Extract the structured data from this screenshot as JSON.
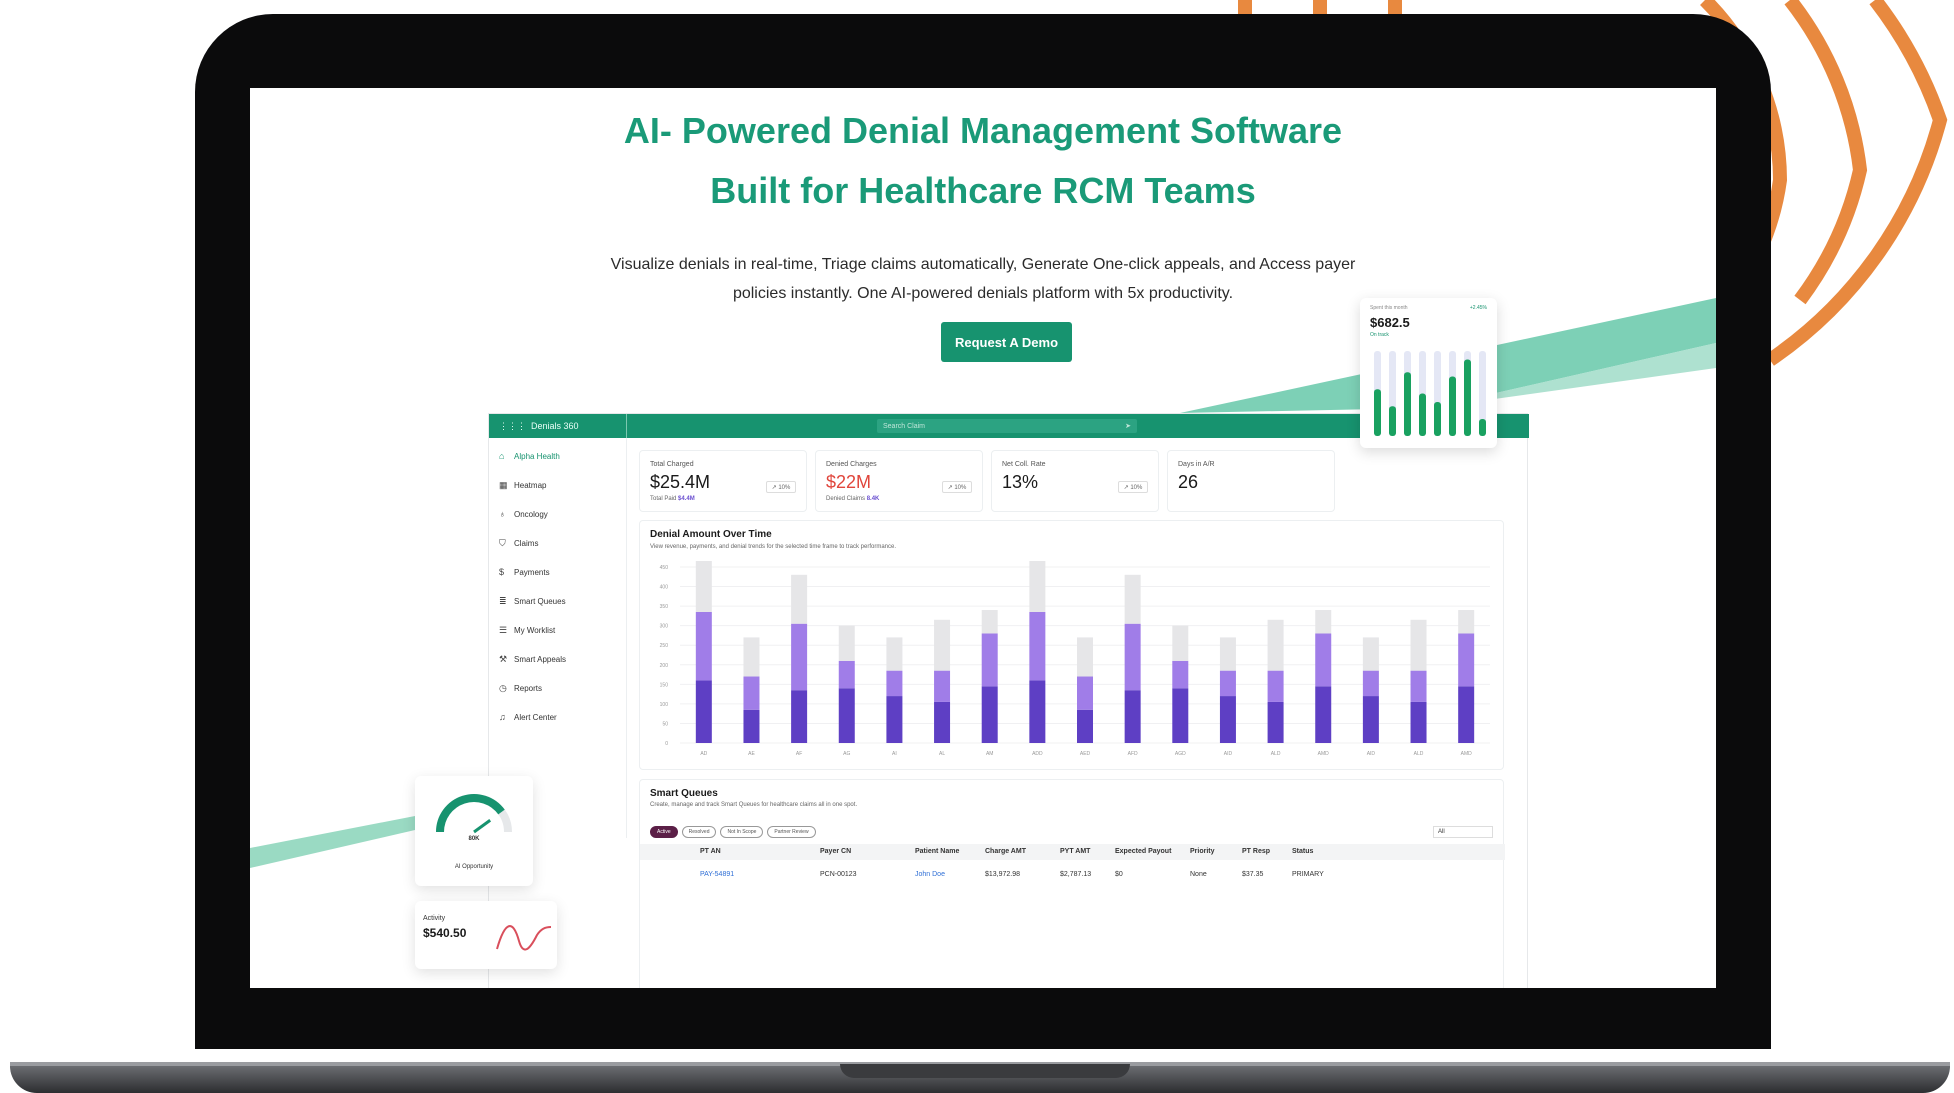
{
  "hero": {
    "title_line1": "AI- Powered Denial Management Software",
    "title_line2": "Built for Healthcare RCM Teams",
    "subtitle_line1": "Visualize denials in real-time, Triage claims automatically, Generate One-click appeals, and Access payer",
    "subtitle_line2": "policies instantly. One AI-powered denials platform with 5x productivity.",
    "cta_label": "Request A Demo"
  },
  "colors": {
    "brand_green": "#17936f",
    "headline_green": "#1a9a78",
    "arc_orange": "#e8893f",
    "bar_dark_purple": "#5e3fc4",
    "bar_light_purple": "#a07de8",
    "bar_grey": "#e6e6e8",
    "accent_red": "#e0453b"
  },
  "dashboard": {
    "brand": "Denials 360",
    "search_placeholder": "Search Claim",
    "sidebar": [
      {
        "label": "Alpha Health",
        "icon": "home-icon",
        "active": true
      },
      {
        "label": "Heatmap",
        "icon": "grid-icon",
        "active": false
      },
      {
        "label": "Oncology",
        "icon": "ribbon-icon",
        "active": false
      },
      {
        "label": "Claims",
        "icon": "shield-icon",
        "active": false
      },
      {
        "label": "Payments",
        "icon": "dollar-icon",
        "active": false
      },
      {
        "label": "Smart Queues",
        "icon": "database-icon",
        "active": false
      },
      {
        "label": "My Worklist",
        "icon": "list-icon",
        "active": false
      },
      {
        "label": "Smart Appeals",
        "icon": "hammer-icon",
        "active": false
      },
      {
        "label": "Reports",
        "icon": "clock-icon",
        "active": false
      },
      {
        "label": "Alert Center",
        "icon": "bell-icon",
        "active": false
      }
    ],
    "kpis": [
      {
        "label": "Total Charged",
        "value": "$25.4M",
        "sub_label": "Total Paid",
        "sub_value": "$4.4M",
        "badge": "↗ 10%"
      },
      {
        "label": "Denied Charges",
        "value": "$22M",
        "sub_label": "Denied Claims",
        "sub_value": "8.4K",
        "badge": "↗ 10%"
      },
      {
        "label": "Net Coll. Rate",
        "value": "13%",
        "sub_label": "",
        "sub_value": "",
        "badge": "↗ 10%"
      },
      {
        "label": "Days in A/R",
        "value": "26",
        "sub_label": "",
        "sub_value": "",
        "badge": ""
      }
    ],
    "chart": {
      "title": "Denial Amount Over Time",
      "subtitle": "View revenue, payments, and denial trends for the selected time frame to track performance."
    },
    "smart_queues": {
      "title": "Smart Queues",
      "subtitle": "Create, manage and track Smart Queues for healthcare claims all in one spot.",
      "tabs": [
        "Active",
        "Resolved",
        "Not In Scope",
        "Partner Review"
      ],
      "filter_value": "All",
      "columns": [
        "PT AN",
        "Payer CN",
        "Patient Name",
        "Charge AMT",
        "PYT AMT",
        "Expected Payout",
        "Priority",
        "PT Resp",
        "Status"
      ],
      "rows": [
        [
          "PAY-54891",
          "PCN-00123",
          "John Doe",
          "$13,972.98",
          "$2,787.13",
          "$0",
          "None",
          "$37.35",
          "PRIMARY"
        ]
      ]
    }
  },
  "floating": {
    "bars_card": {
      "label": "Spent this month",
      "delta": "+2.45%",
      "value": "$682.5",
      "status": "On track",
      "values": [
        0.55,
        0.35,
        0.75,
        0.5,
        0.4,
        0.7,
        0.9,
        0.2
      ]
    },
    "gauge_card": {
      "value": "80K",
      "label": "AI Opportunity",
      "level": 0.8
    },
    "activity_card": {
      "label": "Activity",
      "value": "$540.50"
    }
  },
  "chart_data": {
    "type": "bar",
    "title": "Denial Amount Over Time",
    "categories": [
      "AD",
      "AE",
      "AF",
      "AG",
      "AI",
      "AL",
      "AM",
      "ADD",
      "AED",
      "AFD",
      "AGD",
      "AID",
      "ALD",
      "AMD",
      "AID",
      "ALD",
      "AMD"
    ],
    "yticks": [
      0,
      50,
      100,
      150,
      200,
      250,
      300,
      350,
      400,
      450
    ],
    "ylim": [
      0,
      450
    ],
    "series": [
      {
        "values": [
          160,
          85,
          135,
          140,
          120,
          105,
          145,
          160,
          85,
          135,
          140,
          120,
          105,
          145,
          120,
          105,
          145
        ]
      },
      {
        "values": [
          175,
          85,
          170,
          70,
          65,
          80,
          135,
          175,
          85,
          170,
          70,
          65,
          80,
          135,
          65,
          80,
          135
        ]
      },
      {
        "values": [
          135,
          100,
          125,
          90,
          85,
          130,
          60,
          135,
          100,
          125,
          90,
          85,
          130,
          60,
          85,
          130,
          60
        ]
      }
    ]
  }
}
